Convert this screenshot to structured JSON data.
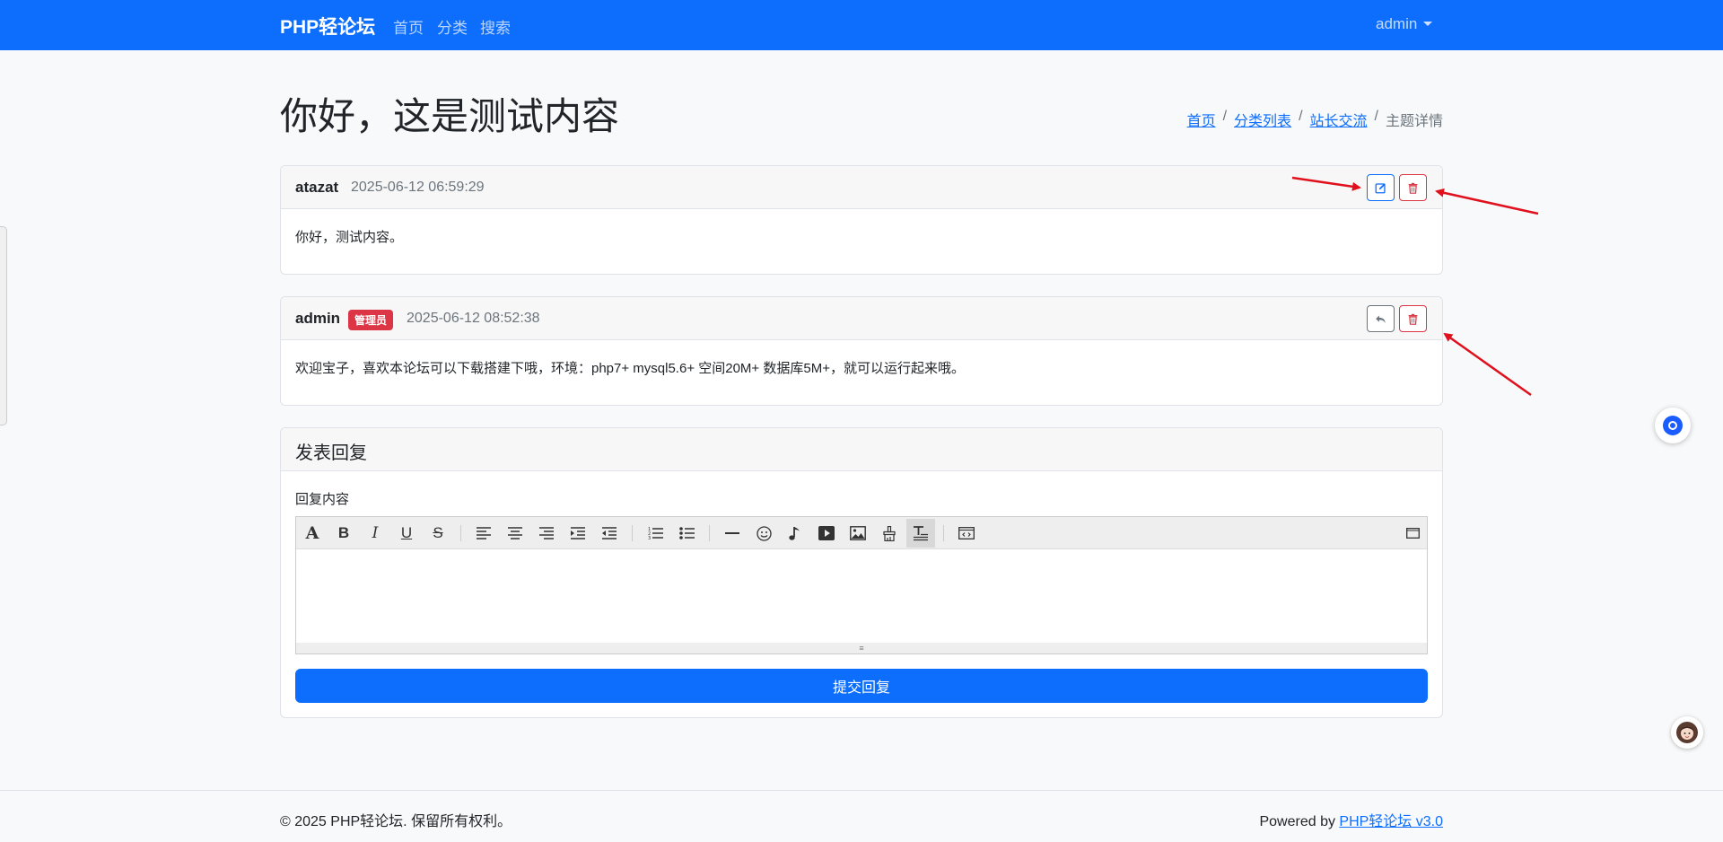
{
  "navbar": {
    "brand": "PHP轻论坛",
    "links": [
      "首页",
      "分类",
      "搜索"
    ],
    "user": "admin"
  },
  "page": {
    "title": "你好，这是测试内容",
    "breadcrumb": [
      "首页",
      "分类列表",
      "站长交流",
      "主题详情"
    ]
  },
  "posts": [
    {
      "author": "atazat",
      "time": "2025-06-12 06:59:29",
      "content": "你好，测试内容。",
      "actions": [
        "edit-icon",
        "trash-icon"
      ]
    },
    {
      "author": "admin",
      "badge": "管理员",
      "time": "2025-06-12 08:52:38",
      "content": "欢迎宝子，喜欢本论坛可以下载搭建下哦，环境：php7+    mysql5.6+    空间20M+   数据库5M+，就可以运行起来哦。",
      "actions": [
        "reply-icon",
        "trash-icon"
      ]
    }
  ],
  "reply_form": {
    "title": "发表回复",
    "label": "回复内容",
    "submit_label": "提交回复",
    "toolbar": {
      "text_tools": [
        "A",
        "B",
        "I",
        "U",
        "S"
      ],
      "icons": [
        "font-icon",
        "bold-icon",
        "italic-icon",
        "underline-icon",
        "strikethrough-icon",
        "align-left-icon",
        "align-center-icon",
        "align-right-icon",
        "indent-icon",
        "outdent-icon",
        "ordered-list-icon",
        "unordered-list-icon",
        "horizontal-rule-icon",
        "emoji-icon",
        "music-icon",
        "video-icon",
        "image-icon",
        "format-painter-icon",
        "clear-format-icon",
        "source-code-icon",
        "fullscreen-icon"
      ]
    }
  },
  "footer": {
    "copyright": "© 2025 PHP轻论坛. 保留所有权利。",
    "powered_prefix": "Powered by ",
    "powered_link": "PHP轻论坛 v3.0"
  },
  "colors": {
    "primary": "#0d6efd",
    "danger": "#dc3545",
    "annotation_arrow": "#e0101d"
  }
}
